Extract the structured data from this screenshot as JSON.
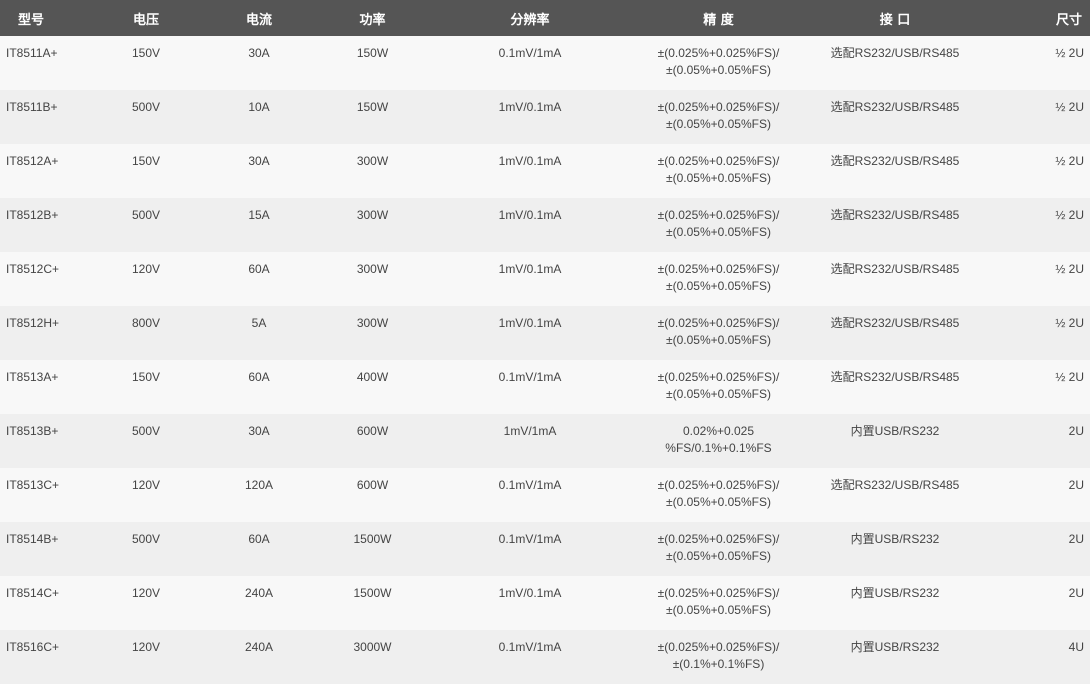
{
  "headers": [
    "型号",
    "电压",
    "电流",
    "功率",
    "分辨率",
    "精 度",
    "接 口",
    "尺寸"
  ],
  "rows": [
    {
      "model": "IT8511A+",
      "voltage": "150V",
      "current": "30A",
      "power": "150W",
      "resolution": "0.1mV/1mA",
      "accuracy": [
        "±(0.025%+0.025%FS)/",
        "±(0.05%+0.05%FS)"
      ],
      "interface": "选配RS232/USB/RS485",
      "size": "½ 2U"
    },
    {
      "model": "IT8511B+",
      "voltage": "500V",
      "current": "10A",
      "power": "150W",
      "resolution": "1mV/0.1mA",
      "accuracy": [
        "±(0.025%+0.025%FS)/",
        "±(0.05%+0.05%FS)"
      ],
      "interface": "选配RS232/USB/RS485",
      "size": "½ 2U"
    },
    {
      "model": "IT8512A+",
      "voltage": "150V",
      "current": "30A",
      "power": "300W",
      "resolution": "1mV/0.1mA",
      "accuracy": [
        "±(0.025%+0.025%FS)/",
        "±(0.05%+0.05%FS)"
      ],
      "interface": "选配RS232/USB/RS485",
      "size": "½ 2U"
    },
    {
      "model": "IT8512B+",
      "voltage": "500V",
      "current": "15A",
      "power": "300W",
      "resolution": "1mV/0.1mA",
      "accuracy": [
        "±(0.025%+0.025%FS)/",
        "±(0.05%+0.05%FS)"
      ],
      "interface": "选配RS232/USB/RS485",
      "size": "½ 2U"
    },
    {
      "model": "IT8512C+",
      "voltage": "120V",
      "current": "60A",
      "power": "300W",
      "resolution": "1mV/0.1mA",
      "accuracy": [
        "±(0.025%+0.025%FS)/",
        "±(0.05%+0.05%FS)"
      ],
      "interface": "选配RS232/USB/RS485",
      "size": "½ 2U"
    },
    {
      "model": "IT8512H+",
      "voltage": "800V",
      "current": "5A",
      "power": "300W",
      "resolution": "1mV/0.1mA",
      "accuracy": [
        "±(0.025%+0.025%FS)/",
        "±(0.05%+0.05%FS)"
      ],
      "interface": "选配RS232/USB/RS485",
      "size": "½ 2U"
    },
    {
      "model": "IT8513A+",
      "voltage": "150V",
      "current": "60A",
      "power": "400W",
      "resolution": "0.1mV/1mA",
      "accuracy": [
        "±(0.025%+0.025%FS)/",
        "±(0.05%+0.05%FS)"
      ],
      "interface": "选配RS232/USB/RS485",
      "size": "½ 2U"
    },
    {
      "model": "IT8513B+",
      "voltage": "500V",
      "current": "30A",
      "power": "600W",
      "resolution": "1mV/1mA",
      "accuracy": [
        "0.02%+0.025",
        "%FS/0.1%+0.1%FS"
      ],
      "interface": "内置USB/RS232",
      "size": "2U"
    },
    {
      "model": "IT8513C+",
      "voltage": "120V",
      "current": "120A",
      "power": "600W",
      "resolution": "0.1mV/1mA",
      "accuracy": [
        "±(0.025%+0.025%FS)/",
        "±(0.05%+0.05%FS)"
      ],
      "interface": "选配RS232/USB/RS485",
      "size": "2U"
    },
    {
      "model": "IT8514B+",
      "voltage": "500V",
      "current": "60A",
      "power": "1500W",
      "resolution": "0.1mV/1mA",
      "accuracy": [
        "±(0.025%+0.025%FS)/",
        "±(0.05%+0.05%FS)"
      ],
      "interface": "内置USB/RS232",
      "size": "2U"
    },
    {
      "model": "IT8514C+",
      "voltage": "120V",
      "current": "240A",
      "power": "1500W",
      "resolution": "1mV/0.1mA",
      "accuracy": [
        "±(0.025%+0.025%FS)/",
        "±(0.05%+0.05%FS)"
      ],
      "interface": "内置USB/RS232",
      "size": "2U"
    },
    {
      "model": "IT8516C+",
      "voltage": "120V",
      "current": "240A",
      "power": "3000W",
      "resolution": "0.1mV/1mA",
      "accuracy": [
        "±(0.025%+0.025%FS)/",
        "±(0.1%+0.1%FS)"
      ],
      "interface": "内置USB/RS232",
      "size": "4U"
    }
  ]
}
